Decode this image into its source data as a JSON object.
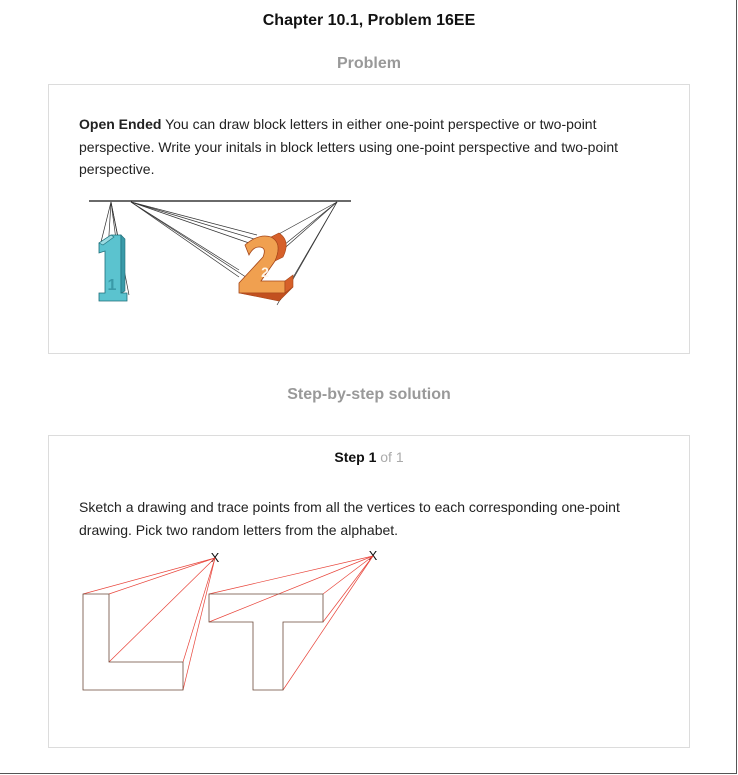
{
  "page": {
    "chapter_title": "Chapter 10.1, Problem 16EE"
  },
  "problem_section": {
    "heading": "Problem",
    "lead": "Open Ended",
    "text": " You can draw block letters in either one-point perspective or two-point perspective. Write your initals in block letters using one-point perspective and two-point perspective.",
    "figure_glyphs": [
      "1",
      "2"
    ]
  },
  "solution_section": {
    "heading": "Step-by-step solution",
    "step_label": "Step 1",
    "step_of": " of 1",
    "step_text": "Sketch a drawing and trace points from all the vertices to each corresponding one-point drawing. Pick two random letters from the alphabet.",
    "vanishing_marks": [
      "X",
      "X"
    ]
  },
  "colors": {
    "heading_gray": "#999999",
    "digit_one": "#5bc3cf",
    "digit_two": "#f0a050",
    "digit_two_dark": "#d6602a",
    "trace_red": "#e8443a"
  }
}
